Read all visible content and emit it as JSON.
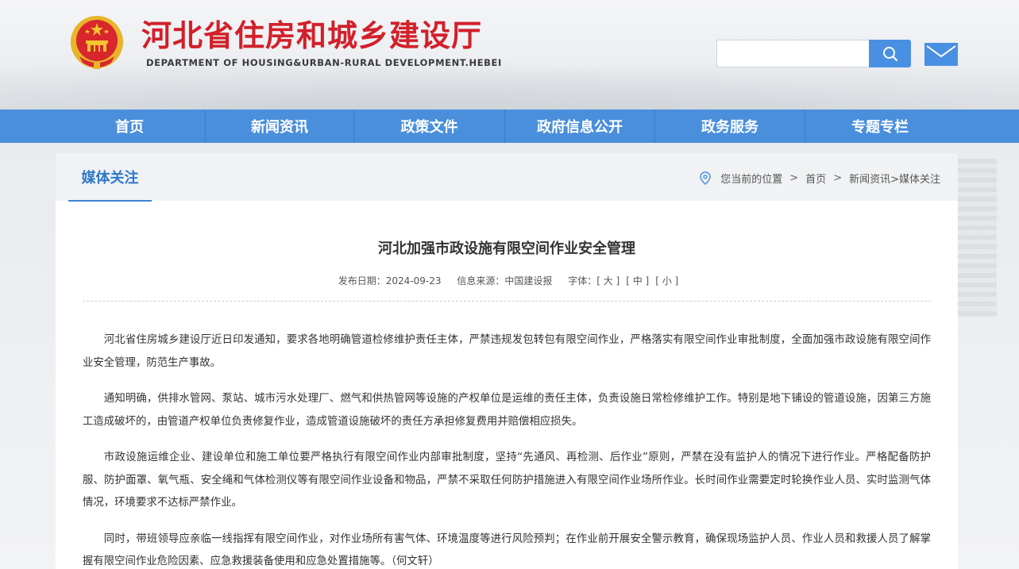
{
  "header": {
    "title": "河北省住房和城乡建设厅",
    "subtitle": "DEPARTMENT OF HOUSING&URBAN-RURAL DEVELOPMENT.HEBEI",
    "search_placeholder": "",
    "search_icon": "search-icon",
    "mail_icon": "mail-icon"
  },
  "nav": {
    "items": [
      "首页",
      "新闻资讯",
      "政策文件",
      "政府信息公开",
      "政务服务",
      "专题专栏"
    ]
  },
  "section": {
    "label": "媒体关注"
  },
  "breadcrumb": {
    "prefix": "您当前的位置",
    "home": "首页",
    "trail": "新闻资讯>媒体关注",
    "separator": ">",
    "icon": "location-pin-icon"
  },
  "article": {
    "title": "河北加强市政设施有限空间作业安全管理",
    "meta": {
      "date_label": "发布日期：",
      "date": "2024-09-23",
      "source_label": "信息来源：",
      "source": "中国建设报",
      "font_label": "字体：",
      "font_large": "[ 大 ]",
      "font_medium": "[ 中 ]",
      "font_small": "[ 小 ]"
    },
    "paragraphs": [
      "河北省住房城乡建设厅近日印发通知，要求各地明确管道检修维护责任主体，严禁违规发包转包有限空间作业，严格落实有限空间作业审批制度，全面加强市政设施有限空间作业安全管理，防范生产事故。",
      "通知明确，供排水管网、泵站、城市污水处理厂、燃气和供热管网等设施的产权单位是运维的责任主体，负责设施日常检修维护工作。特别是地下铺设的管道设施，因第三方施工造成破坏的，由管道产权单位负责修复作业，造成管道设施破坏的责任方承担修复费用并赔偿相应损失。",
      "市政设施运维企业、建设单位和施工单位要严格执行有限空间作业内部审批制度，坚持“先通风、再检测、后作业”原则，严禁在没有监护人的情况下进行作业。严格配备防护服、防护面罩、氧气瓶、安全绳和气体检测仪等有限空间作业设备和物品，严禁不采取任何防护措施进入有限空间作业场所作业。长时间作业需要定时轮换作业人员、实时监测气体情况，环境要求不达标严禁作业。",
      "同时，带班领导应亲临一线指挥有限空间作业，对作业场所有害气体、环境温度等进行风险预判；在作业前开展安全警示教育，确保现场监护人员、作业人员和救援人员了解掌握有限空间作业危险因素、应急救援装备使用和应急处置措施等。（何文轩）"
    ]
  },
  "colors": {
    "title_red": "#d2202a",
    "nav_blue": "#4a8fdc",
    "accent_blue": "#2d78c8"
  }
}
